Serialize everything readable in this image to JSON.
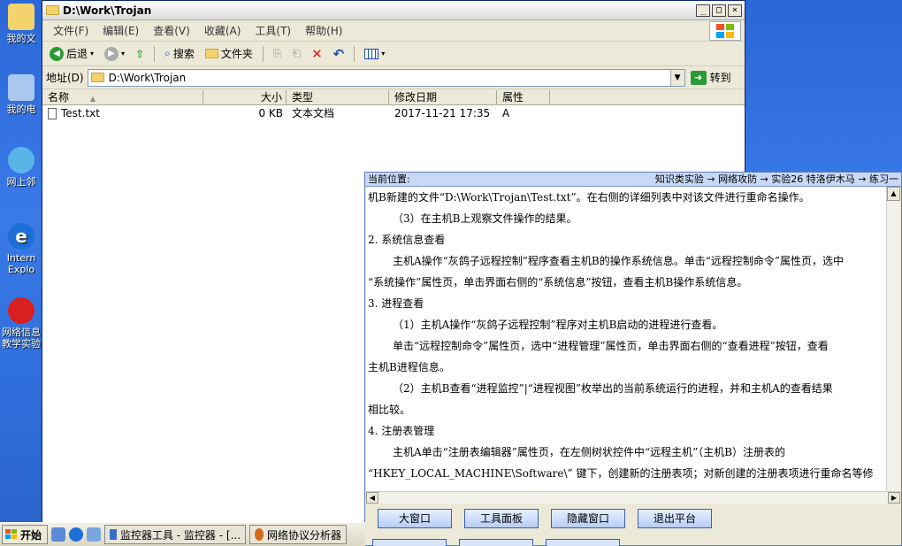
{
  "desktop": {
    "icons": [
      {
        "label": "我的文",
        "icon": "folder-documents-icon",
        "color": "#f3d36b"
      },
      {
        "label": "我的电",
        "icon": "computer-icon",
        "color": "#a9c8f0"
      },
      {
        "label": "网上邻",
        "icon": "network-icon",
        "color": "#5bb4e8"
      },
      {
        "label": "Intern",
        "label2": "Explo",
        "icon": "internet-explorer-icon",
        "color": "#1b6fd6"
      },
      {
        "label": "网络信息",
        "label2": "教学实验",
        "icon": "lab-app-icon",
        "color": "#d92020"
      }
    ]
  },
  "explorer": {
    "title": "D:\\Work\\Trojan",
    "menu": [
      "文件(F)",
      "编辑(E)",
      "查看(V)",
      "收藏(A)",
      "工具(T)",
      "帮助(H)"
    ],
    "toolbar": {
      "back": "后退",
      "search": "搜索",
      "folders": "文件夹"
    },
    "address_label": "地址(D)",
    "address_value": "D:\\Work\\Trojan",
    "go_label": "转到",
    "columns": [
      "名称",
      "大小",
      "类型",
      "修改日期",
      "属性"
    ],
    "files": [
      {
        "name": "Test.txt",
        "size": "0 KB",
        "type": "文本文档",
        "modified": "2017-11-21 17:35",
        "attr": "A"
      }
    ]
  },
  "guide": {
    "location_label": "当前位置:",
    "breadcrumb": "知识类实验 → 网络攻防 → 实验26 特洛伊木马 → 练习一",
    "lines": [
      {
        "text": "机B新建的文件“D:\\Work\\Trojan\\Test.txt”。在右侧的详细列表中对该文件进行重命名操作。",
        "indent": false
      },
      {
        "text": "（3）在主机B上观察文件操作的结果。",
        "indent": true
      },
      {
        "text": "2. 系统信息查看",
        "indent": false
      },
      {
        "text": "主机A操作“灰鸽子远程控制”程序查看主机B的操作系统信息。单击“远程控制命令”属性页，选中",
        "indent": true
      },
      {
        "text": "“系统操作”属性页，单击界面右侧的“系统信息”按钮，查看主机B操作系统信息。",
        "indent": false
      },
      {
        "text": "3. 进程查看",
        "indent": false
      },
      {
        "text": "（1）主机A操作“灰鸽子远程控制”程序对主机B启动的进程进行查看。",
        "indent": true
      },
      {
        "text": "单击“远程控制命令”属性页，选中“进程管理”属性页，单击界面右侧的“查看进程”按钮，查看",
        "indent": true
      },
      {
        "text": "主机B进程信息。",
        "indent": false
      },
      {
        "text": "（2）主机B查看“进程监控”|“进程视图”枚举出的当前系统运行的进程，并和主机A的查看结果",
        "indent": true
      },
      {
        "text": "相比较。",
        "indent": false
      },
      {
        "text": "4. 注册表管理",
        "indent": false
      },
      {
        "text": "主机A单击“注册表编辑器”属性页，在左侧树状控件中“远程主机”（主机B）注册表的",
        "indent": true
      },
      {
        "text": "“HKEY_LOCAL_MACHINE\\Software\\” 键下，创建新的注册表项；对新创建的注册表项进行重命名等修",
        "indent": false
      }
    ],
    "buttons": [
      "大窗口",
      "工具面板",
      "隐藏窗口",
      "退出平台"
    ]
  },
  "taskbar": {
    "start": "开始",
    "tasks": [
      "监控器工具 - 监控器 - [...",
      "网络协议分析器"
    ]
  }
}
